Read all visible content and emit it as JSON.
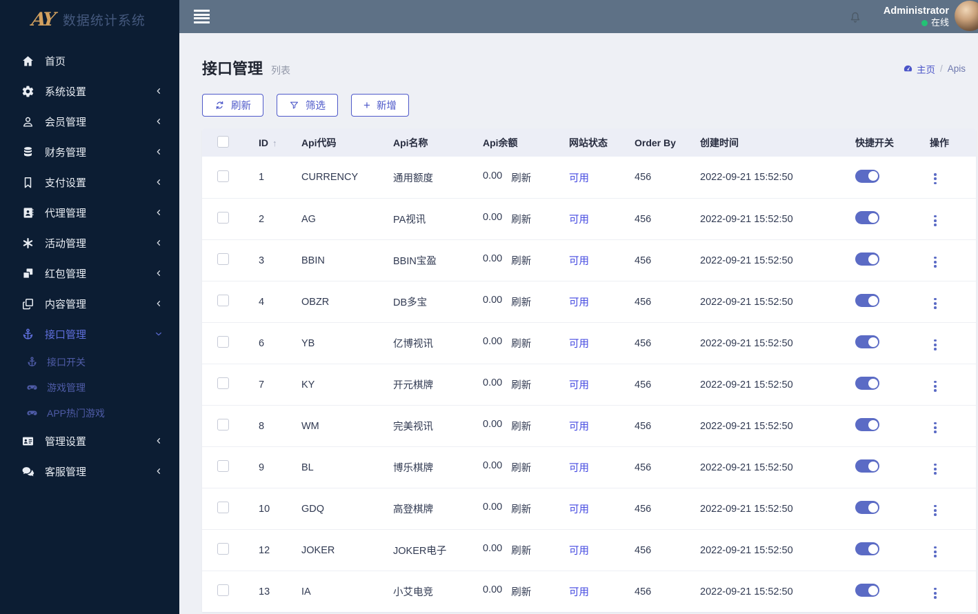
{
  "brand": {
    "logo": "AY",
    "title": "数据统计系统"
  },
  "topbar": {
    "hamburger_icon": "hamburger-icon",
    "bell_icon": "bell-icon",
    "username": "Administrator",
    "online_status": "在线"
  },
  "sidebar": {
    "items": [
      {
        "label": "首页",
        "icon": "home-icon",
        "chevron": "none",
        "active": false
      },
      {
        "label": "系统设置",
        "icon": "gears-icon",
        "chevron": "left",
        "active": false
      },
      {
        "label": "会员管理",
        "icon": "user-icon",
        "chevron": "left",
        "active": false
      },
      {
        "label": "财务管理",
        "icon": "database-icon",
        "chevron": "left",
        "active": false
      },
      {
        "label": "支付设置",
        "icon": "bookmark-icon",
        "chevron": "left",
        "active": false
      },
      {
        "label": "代理管理",
        "icon": "agent-card-icon",
        "chevron": "left",
        "active": false
      },
      {
        "label": "活动管理",
        "icon": "asterisk-icon",
        "chevron": "left",
        "active": false
      },
      {
        "label": "红包管理",
        "icon": "cubes-icon",
        "chevron": "left",
        "active": false
      },
      {
        "label": "内容管理",
        "icon": "copy-icon",
        "chevron": "left",
        "active": false
      },
      {
        "label": "接口管理",
        "icon": "anchor-icon",
        "chevron": "down",
        "active": true,
        "children": [
          {
            "label": "接口开关",
            "icon": "anchor-icon"
          },
          {
            "label": "游戏管理",
            "icon": "gamepad-icon"
          },
          {
            "label": "APP热门游戏",
            "icon": "gamepad-icon"
          }
        ]
      },
      {
        "label": "管理设置",
        "icon": "idcard-icon",
        "chevron": "left",
        "active": false
      },
      {
        "label": "客服管理",
        "icon": "chat-icon",
        "chevron": "left",
        "active": false
      }
    ]
  },
  "page": {
    "title": "接口管理",
    "subtitle": "列表",
    "breadcrumb": {
      "home_icon": "dashboard-icon",
      "home": "主页",
      "separator": "/",
      "current": "Apis"
    }
  },
  "toolbar": {
    "refresh_label": "刷新",
    "refresh_icon": "refresh-icon",
    "filter_label": "筛选",
    "filter_icon": "filter-icon",
    "add_label": "新增",
    "add_icon": "plus-icon"
  },
  "table": {
    "headers": {
      "id": "ID",
      "sort_arrow": "↑",
      "code": "Api代码",
      "name": "Api名称",
      "balance": "Api余额",
      "site_status": "网站状态",
      "order_by": "Order By",
      "created": "创建时间",
      "quick_switch": "快捷开关",
      "actions": "操作"
    },
    "rows": [
      {
        "id": "1",
        "code": "CURRENCY",
        "name": "通用额度",
        "balance": "0.00",
        "refresh": "刷新",
        "status": "可用",
        "order_by": "456",
        "created": "2022-09-21 15:52:50",
        "switch_on": true
      },
      {
        "id": "2",
        "code": "AG",
        "name": "PA视讯",
        "balance": "0.00",
        "refresh": "刷新",
        "status": "可用",
        "order_by": "456",
        "created": "2022-09-21 15:52:50",
        "switch_on": true
      },
      {
        "id": "3",
        "code": "BBIN",
        "name": "BBIN宝盈",
        "balance": "0.00",
        "refresh": "刷新",
        "status": "可用",
        "order_by": "456",
        "created": "2022-09-21 15:52:50",
        "switch_on": true
      },
      {
        "id": "4",
        "code": "OBZR",
        "name": "DB多宝",
        "balance": "0.00",
        "refresh": "刷新",
        "status": "可用",
        "order_by": "456",
        "created": "2022-09-21 15:52:50",
        "switch_on": true
      },
      {
        "id": "6",
        "code": "YB",
        "name": "亿博视讯",
        "balance": "0.00",
        "refresh": "刷新",
        "status": "可用",
        "order_by": "456",
        "created": "2022-09-21 15:52:50",
        "switch_on": true
      },
      {
        "id": "7",
        "code": "KY",
        "name": "开元棋牌",
        "balance": "0.00",
        "refresh": "刷新",
        "status": "可用",
        "order_by": "456",
        "created": "2022-09-21 15:52:50",
        "switch_on": true
      },
      {
        "id": "8",
        "code": "WM",
        "name": "完美视讯",
        "balance": "0.00",
        "refresh": "刷新",
        "status": "可用",
        "order_by": "456",
        "created": "2022-09-21 15:52:50",
        "switch_on": true
      },
      {
        "id": "9",
        "code": "BL",
        "name": "博乐棋牌",
        "balance": "0.00",
        "refresh": "刷新",
        "status": "可用",
        "order_by": "456",
        "created": "2022-09-21 15:52:50",
        "switch_on": true
      },
      {
        "id": "10",
        "code": "GDQ",
        "name": "高登棋牌",
        "balance": "0.00",
        "refresh": "刷新",
        "status": "可用",
        "order_by": "456",
        "created": "2022-09-21 15:52:50",
        "switch_on": true
      },
      {
        "id": "12",
        "code": "JOKER",
        "name": "JOKER电子",
        "balance": "0.00",
        "refresh": "刷新",
        "status": "可用",
        "order_by": "456",
        "created": "2022-09-21 15:52:50",
        "switch_on": true
      },
      {
        "id": "13",
        "code": "IA",
        "name": "小艾电竞",
        "balance": "0.00",
        "refresh": "刷新",
        "status": "可用",
        "order_by": "456",
        "created": "2022-09-21 15:52:50",
        "switch_on": true
      }
    ]
  },
  "colors": {
    "sidebar_bg": "#0c1d33",
    "topbar_bg": "#5e7186",
    "accent": "#4d58c9",
    "link_blue": "#4247e0",
    "toggle_on": "#5b6bc5",
    "status_green": "#23c275",
    "logo_gold": "#d2a05f",
    "page_bg": "#eef0f5",
    "header_row_bg": "#eceef6"
  }
}
